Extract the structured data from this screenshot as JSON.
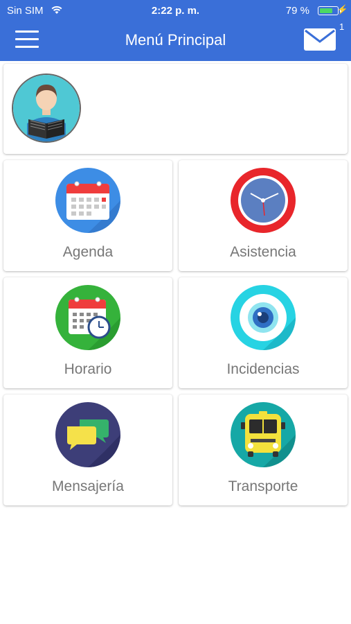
{
  "status_bar": {
    "carrier": "Sin SIM",
    "time": "2:22 p. m.",
    "battery_percent": "79 %",
    "battery_level": 0.79
  },
  "header": {
    "title": "Menú Principal",
    "mail_badge": "1",
    "background_color": "#3a6fd8"
  },
  "menu": {
    "items": [
      {
        "label": "Agenda",
        "icon": "calendar-icon"
      },
      {
        "label": "Asistencia",
        "icon": "clock-icon"
      },
      {
        "label": "Horario",
        "icon": "schedule-icon"
      },
      {
        "label": "Incidencias",
        "icon": "eye-icon"
      },
      {
        "label": "Mensajería",
        "icon": "chat-icon"
      },
      {
        "label": "Transporte",
        "icon": "bus-icon"
      }
    ]
  }
}
